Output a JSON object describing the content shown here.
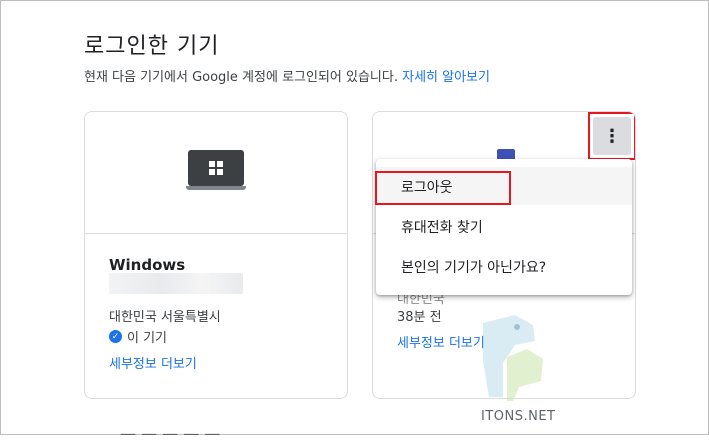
{
  "heading": "로그인한 기기",
  "subtitle_text": "현재 다음 기기에서 Google 계정에 로그인되어 있습니다.",
  "learn_more": "자세히 알아보기",
  "device1": {
    "name": "Windows",
    "location": "대한민국 서울특별시",
    "this_device": "이 기기",
    "details_link": "세부정보 더보기",
    "icon": "laptop-windows-icon"
  },
  "device2": {
    "location_partial": "대한민국",
    "time": "38분 전",
    "details_link": "세부정보 더보기",
    "icon": "phone-icon",
    "more_icon": "more-vert-icon"
  },
  "menu": {
    "items": [
      "로그아웃",
      "휴대전화 찾기",
      "본인의 기기가 아닌가요?"
    ]
  },
  "watermark": "ITONS.NET",
  "colors": {
    "link": "#1a73e8",
    "highlight": "#e8171f"
  }
}
